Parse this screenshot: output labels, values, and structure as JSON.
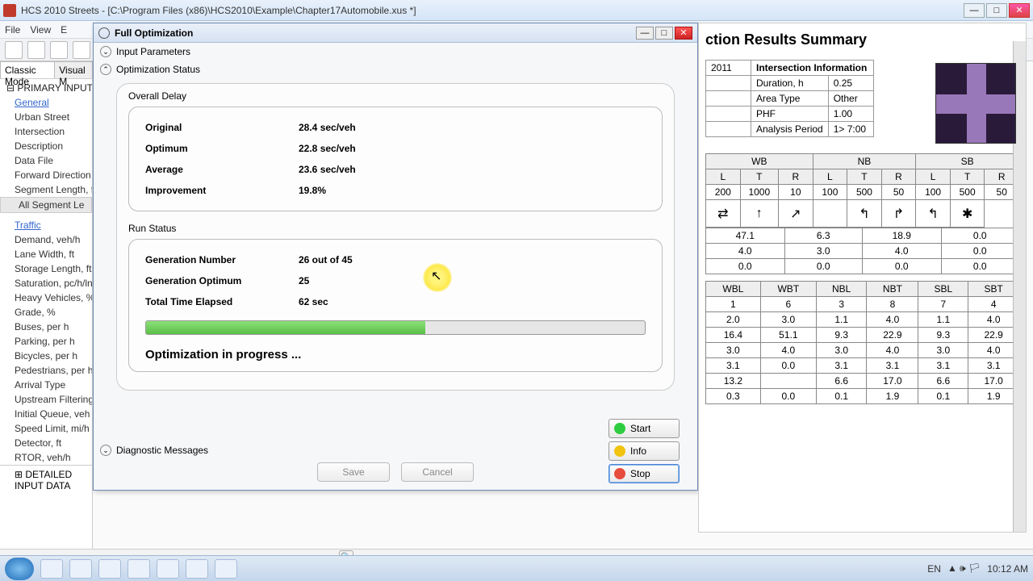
{
  "window": {
    "title": "HCS 2010 Streets - [C:\\Program Files (x86)\\HCS2010\\Example\\Chapter17Automobile.xus *]"
  },
  "menubar": [
    "File",
    "View",
    "E"
  ],
  "left_panel": {
    "tabs": [
      "Classic Mode",
      "Visual M"
    ],
    "active_tab": 0,
    "primary_header": "PRIMARY INPUT",
    "primary_items": [
      "General",
      "Urban Street",
      "Intersection",
      "Description",
      "Data File",
      "Forward Direction",
      "Segment Length, ft"
    ],
    "all_segments": "All Segment Le",
    "traffic_header": "Traffic",
    "traffic_items": [
      "Demand, veh/h",
      "Lane Width, ft",
      "Storage Length, ft",
      "Saturation, pc/h/ln",
      "Heavy Vehicles, %",
      "Grade, %",
      "Buses, per h",
      "Parking, per h",
      "Bicycles, per h",
      "Pedestrians, per h",
      "Arrival Type",
      "Upstream Filtering (I)",
      "Initial Queue, veh",
      "Speed Limit, mi/h",
      "Detector, ft",
      "RTOR, veh/h"
    ],
    "detailed_header": "DETAILED INPUT DATA"
  },
  "dialog": {
    "title": "Full Optimization",
    "sections": {
      "input": "Input Parameters",
      "status": "Optimization Status",
      "diag": "Diagnostic Messages"
    },
    "overall_delay": {
      "title": "Overall Delay",
      "rows": [
        {
          "k": "Original",
          "v": "28.4 sec/veh"
        },
        {
          "k": "Optimum",
          "v": "22.8 sec/veh"
        },
        {
          "k": "Average",
          "v": "23.6 sec/veh"
        },
        {
          "k": "Improvement",
          "v": "19.8%"
        }
      ]
    },
    "run_status": {
      "title": "Run Status",
      "rows": [
        {
          "k": "Generation Number",
          "v": "26 out of 45"
        },
        {
          "k": "Generation Optimum",
          "v": "25"
        },
        {
          "k": "Total Time Elapsed",
          "v": "62 sec"
        }
      ],
      "progress_msg": "Optimization in progress ..."
    },
    "buttons": {
      "start": "Start",
      "info": "Info",
      "stop": "Stop",
      "save": "Save",
      "cancel": "Cancel"
    }
  },
  "results": {
    "header": "ction Results Summary",
    "info_title": "Intersection Information",
    "info_rows": [
      {
        "k": "Duration, h",
        "v": "0.25"
      },
      {
        "k": "Area Type",
        "v": "Other"
      },
      {
        "k": "PHF",
        "v": "1.00"
      },
      {
        "k": "Analysis Period",
        "v": "1> 7:00"
      }
    ],
    "left_col_val": "2011",
    "approach_headers": [
      "WB",
      "NB",
      "SB"
    ],
    "ltr": [
      "L",
      "T",
      "R",
      "L",
      "T",
      "R",
      "L",
      "T",
      "R"
    ],
    "flow_row1": [
      "200",
      "1000",
      "10",
      "100",
      "500",
      "50",
      "100",
      "500",
      "50"
    ],
    "arrow_labels": [
      "⇄",
      "↑",
      "↗",
      "",
      "↰",
      "↱",
      "↰",
      "✱"
    ],
    "metrics": {
      "r1": [
        "47.1",
        "6.3",
        "18.9",
        "0.0"
      ],
      "r2": [
        "4.0",
        "3.0",
        "4.0",
        "0.0"
      ],
      "r3": [
        "0.0",
        "0.0",
        "0.0",
        "0.0"
      ]
    },
    "arrow2": [
      "",
      "↰",
      "↱",
      "↰",
      "✱"
    ],
    "movements": [
      "WBL",
      "WBT",
      "NBL",
      "NBT",
      "SBL",
      "SBT"
    ],
    "data_rows": [
      [
        "1",
        "6",
        "3",
        "8",
        "7",
        "4"
      ],
      [
        "2.0",
        "3.0",
        "1.1",
        "4.0",
        "1.1",
        "4.0"
      ],
      [
        "16.4",
        "51.1",
        "9.3",
        "22.9",
        "9.3",
        "22.9"
      ],
      [
        "3.0",
        "4.0",
        "3.0",
        "4.0",
        "3.0",
        "4.0"
      ],
      [
        "3.1",
        "0.0",
        "3.1",
        "3.1",
        "3.1",
        "3.1"
      ],
      [
        "13.2",
        "",
        "6.6",
        "17.0",
        "6.6",
        "17.0"
      ],
      [
        "0.3",
        "0.0",
        "0.1",
        "1.9",
        "0.1",
        "1.9"
      ]
    ]
  },
  "tray": {
    "lang": "EN",
    "time": "10:12 AM",
    "date": ""
  }
}
